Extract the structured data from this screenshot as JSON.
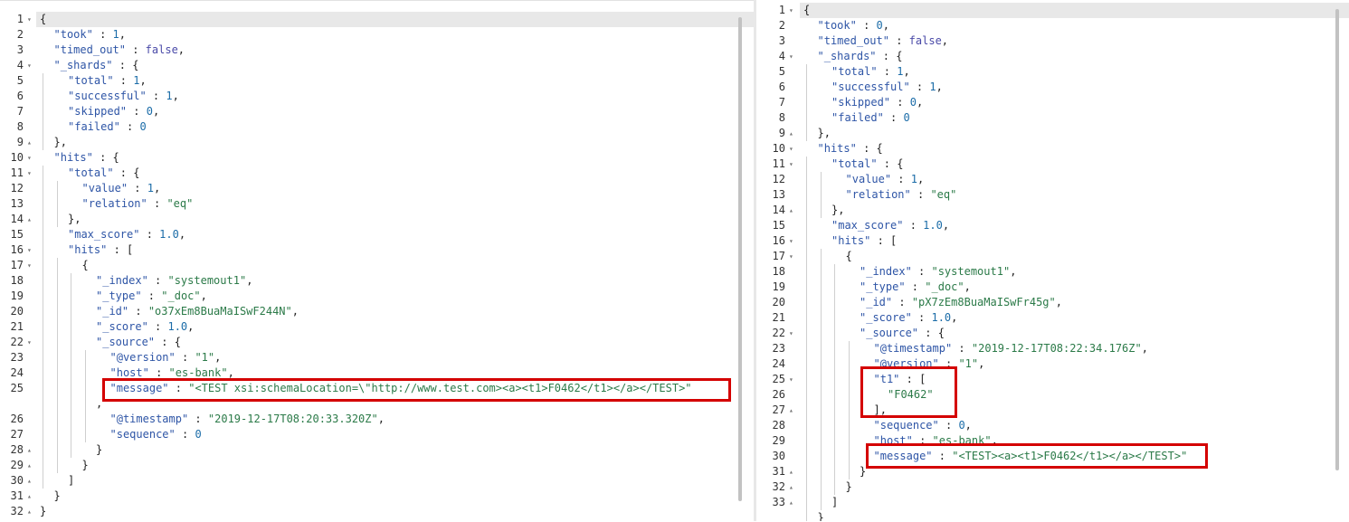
{
  "left_editor": {
    "lines": [
      {
        "n": "1",
        "fold": "down",
        "segs": [
          [
            "p",
            "{"
          ]
        ]
      },
      {
        "n": "2",
        "segs": [
          [
            "k",
            "\"took\""
          ],
          [
            "p",
            " : "
          ],
          [
            "n",
            "1"
          ],
          [
            "p",
            ","
          ]
        ]
      },
      {
        "n": "3",
        "segs": [
          [
            "k",
            "\"timed_out\""
          ],
          [
            "p",
            " : "
          ],
          [
            "b",
            "false"
          ],
          [
            "p",
            ","
          ]
        ]
      },
      {
        "n": "4",
        "fold": "down",
        "segs": [
          [
            "k",
            "\"_shards\""
          ],
          [
            "p",
            " : {"
          ]
        ]
      },
      {
        "n": "5",
        "segs": [
          [
            "k",
            "\"total\""
          ],
          [
            "p",
            " : "
          ],
          [
            "n",
            "1"
          ],
          [
            "p",
            ","
          ]
        ]
      },
      {
        "n": "6",
        "segs": [
          [
            "k",
            "\"successful\""
          ],
          [
            "p",
            " : "
          ],
          [
            "n",
            "1"
          ],
          [
            "p",
            ","
          ]
        ]
      },
      {
        "n": "7",
        "segs": [
          [
            "k",
            "\"skipped\""
          ],
          [
            "p",
            " : "
          ],
          [
            "n",
            "0"
          ],
          [
            "p",
            ","
          ]
        ]
      },
      {
        "n": "8",
        "segs": [
          [
            "k",
            "\"failed\""
          ],
          [
            "p",
            " : "
          ],
          [
            "n",
            "0"
          ]
        ]
      },
      {
        "n": "9",
        "fold": "up",
        "segs": [
          [
            "p",
            "},"
          ]
        ]
      },
      {
        "n": "10",
        "fold": "down",
        "segs": [
          [
            "k",
            "\"hits\""
          ],
          [
            "p",
            " : {"
          ]
        ]
      },
      {
        "n": "11",
        "fold": "down",
        "segs": [
          [
            "k",
            "\"total\""
          ],
          [
            "p",
            " : {"
          ]
        ]
      },
      {
        "n": "12",
        "segs": [
          [
            "k",
            "\"value\""
          ],
          [
            "p",
            " : "
          ],
          [
            "n",
            "1"
          ],
          [
            "p",
            ","
          ]
        ]
      },
      {
        "n": "13",
        "segs": [
          [
            "k",
            "\"relation\""
          ],
          [
            "p",
            " : "
          ],
          [
            "s",
            "\"eq\""
          ]
        ]
      },
      {
        "n": "14",
        "fold": "up",
        "segs": [
          [
            "p",
            "},"
          ]
        ]
      },
      {
        "n": "15",
        "segs": [
          [
            "k",
            "\"max_score\""
          ],
          [
            "p",
            " : "
          ],
          [
            "n",
            "1.0"
          ],
          [
            "p",
            ","
          ]
        ]
      },
      {
        "n": "16",
        "fold": "down",
        "segs": [
          [
            "k",
            "\"hits\""
          ],
          [
            "p",
            " : ["
          ]
        ]
      },
      {
        "n": "17",
        "fold": "down",
        "segs": [
          [
            "p",
            "{"
          ]
        ]
      },
      {
        "n": "18",
        "segs": [
          [
            "k",
            "\"_index\""
          ],
          [
            "p",
            " : "
          ],
          [
            "s",
            "\"systemout1\""
          ],
          [
            "p",
            ","
          ]
        ]
      },
      {
        "n": "19",
        "segs": [
          [
            "k",
            "\"_type\""
          ],
          [
            "p",
            " : "
          ],
          [
            "s",
            "\"_doc\""
          ],
          [
            "p",
            ","
          ]
        ]
      },
      {
        "n": "20",
        "segs": [
          [
            "k",
            "\"_id\""
          ],
          [
            "p",
            " : "
          ],
          [
            "s",
            "\"o37xEm8BuaMaISwF244N\""
          ],
          [
            "p",
            ","
          ]
        ]
      },
      {
        "n": "21",
        "segs": [
          [
            "k",
            "\"_score\""
          ],
          [
            "p",
            " : "
          ],
          [
            "n",
            "1.0"
          ],
          [
            "p",
            ","
          ]
        ]
      },
      {
        "n": "22",
        "fold": "down",
        "segs": [
          [
            "k",
            "\"_source\""
          ],
          [
            "p",
            " : {"
          ]
        ]
      },
      {
        "n": "23",
        "segs": [
          [
            "k",
            "\"@version\""
          ],
          [
            "p",
            " : "
          ],
          [
            "s",
            "\"1\""
          ],
          [
            "p",
            ","
          ]
        ]
      },
      {
        "n": "24",
        "segs": [
          [
            "k",
            "\"host\""
          ],
          [
            "p",
            " : "
          ],
          [
            "s",
            "\"es-bank\""
          ],
          [
            "p",
            ","
          ]
        ]
      },
      {
        "n": "25",
        "segs": [
          [
            "k",
            "\"message\""
          ],
          [
            "p",
            " : "
          ],
          [
            "s",
            "\"<TEST xsi:schemaLocation=\\\"http://www.test.com><a><t1>F0462</t1></a></TEST>\""
          ]
        ]
      },
      {
        "n": "",
        "segs": [
          [
            "p",
            ","
          ]
        ]
      },
      {
        "n": "26",
        "segs": [
          [
            "k",
            "\"@timestamp\""
          ],
          [
            "p",
            " : "
          ],
          [
            "s",
            "\"2019-12-17T08:20:33.320Z\""
          ],
          [
            "p",
            ","
          ]
        ]
      },
      {
        "n": "27",
        "segs": [
          [
            "k",
            "\"sequence\""
          ],
          [
            "p",
            " : "
          ],
          [
            "n",
            "0"
          ]
        ]
      },
      {
        "n": "28",
        "fold": "up",
        "segs": [
          [
            "p",
            "}"
          ]
        ]
      },
      {
        "n": "29",
        "fold": "up",
        "segs": [
          [
            "p",
            "}"
          ]
        ]
      },
      {
        "n": "30",
        "fold": "up",
        "segs": [
          [
            "p",
            "]"
          ]
        ]
      },
      {
        "n": "31",
        "fold": "up",
        "segs": [
          [
            "p",
            "}"
          ]
        ]
      },
      {
        "n": "32",
        "fold": "up",
        "segs": [
          [
            "p",
            "}"
          ]
        ]
      }
    ]
  },
  "right_editor": {
    "lines": [
      {
        "n": "1",
        "fold": "down",
        "segs": [
          [
            "p",
            "{"
          ]
        ]
      },
      {
        "n": "2",
        "segs": [
          [
            "k",
            "\"took\""
          ],
          [
            "p",
            " : "
          ],
          [
            "n",
            "0"
          ],
          [
            "p",
            ","
          ]
        ]
      },
      {
        "n": "3",
        "segs": [
          [
            "k",
            "\"timed_out\""
          ],
          [
            "p",
            " : "
          ],
          [
            "b",
            "false"
          ],
          [
            "p",
            ","
          ]
        ]
      },
      {
        "n": "4",
        "fold": "down",
        "segs": [
          [
            "k",
            "\"_shards\""
          ],
          [
            "p",
            " : {"
          ]
        ]
      },
      {
        "n": "5",
        "segs": [
          [
            "k",
            "\"total\""
          ],
          [
            "p",
            " : "
          ],
          [
            "n",
            "1"
          ],
          [
            "p",
            ","
          ]
        ]
      },
      {
        "n": "6",
        "segs": [
          [
            "k",
            "\"successful\""
          ],
          [
            "p",
            " : "
          ],
          [
            "n",
            "1"
          ],
          [
            "p",
            ","
          ]
        ]
      },
      {
        "n": "7",
        "segs": [
          [
            "k",
            "\"skipped\""
          ],
          [
            "p",
            " : "
          ],
          [
            "n",
            "0"
          ],
          [
            "p",
            ","
          ]
        ]
      },
      {
        "n": "8",
        "segs": [
          [
            "k",
            "\"failed\""
          ],
          [
            "p",
            " : "
          ],
          [
            "n",
            "0"
          ]
        ]
      },
      {
        "n": "9",
        "fold": "up",
        "segs": [
          [
            "p",
            "},"
          ]
        ]
      },
      {
        "n": "10",
        "fold": "down",
        "segs": [
          [
            "k",
            "\"hits\""
          ],
          [
            "p",
            " : {"
          ]
        ]
      },
      {
        "n": "11",
        "fold": "down",
        "segs": [
          [
            "k",
            "\"total\""
          ],
          [
            "p",
            " : {"
          ]
        ]
      },
      {
        "n": "12",
        "segs": [
          [
            "k",
            "\"value\""
          ],
          [
            "p",
            " : "
          ],
          [
            "n",
            "1"
          ],
          [
            "p",
            ","
          ]
        ]
      },
      {
        "n": "13",
        "segs": [
          [
            "k",
            "\"relation\""
          ],
          [
            "p",
            " : "
          ],
          [
            "s",
            "\"eq\""
          ]
        ]
      },
      {
        "n": "14",
        "fold": "up",
        "segs": [
          [
            "p",
            "},"
          ]
        ]
      },
      {
        "n": "15",
        "segs": [
          [
            "k",
            "\"max_score\""
          ],
          [
            "p",
            " : "
          ],
          [
            "n",
            "1.0"
          ],
          [
            "p",
            ","
          ]
        ]
      },
      {
        "n": "16",
        "fold": "down",
        "segs": [
          [
            "k",
            "\"hits\""
          ],
          [
            "p",
            " : ["
          ]
        ]
      },
      {
        "n": "17",
        "fold": "down",
        "segs": [
          [
            "p",
            "{"
          ]
        ]
      },
      {
        "n": "18",
        "segs": [
          [
            "k",
            "\"_index\""
          ],
          [
            "p",
            " : "
          ],
          [
            "s",
            "\"systemout1\""
          ],
          [
            "p",
            ","
          ]
        ]
      },
      {
        "n": "19",
        "segs": [
          [
            "k",
            "\"_type\""
          ],
          [
            "p",
            " : "
          ],
          [
            "s",
            "\"_doc\""
          ],
          [
            "p",
            ","
          ]
        ]
      },
      {
        "n": "20",
        "segs": [
          [
            "k",
            "\"_id\""
          ],
          [
            "p",
            " : "
          ],
          [
            "s",
            "\"pX7zEm8BuaMaISwFr45g\""
          ],
          [
            "p",
            ","
          ]
        ]
      },
      {
        "n": "21",
        "segs": [
          [
            "k",
            "\"_score\""
          ],
          [
            "p",
            " : "
          ],
          [
            "n",
            "1.0"
          ],
          [
            "p",
            ","
          ]
        ]
      },
      {
        "n": "22",
        "fold": "down",
        "segs": [
          [
            "k",
            "\"_source\""
          ],
          [
            "p",
            " : {"
          ]
        ]
      },
      {
        "n": "23",
        "segs": [
          [
            "k",
            "\"@timestamp\""
          ],
          [
            "p",
            " : "
          ],
          [
            "s",
            "\"2019-12-17T08:22:34.176Z\""
          ],
          [
            "p",
            ","
          ]
        ]
      },
      {
        "n": "24",
        "segs": [
          [
            "k",
            "\"@version\""
          ],
          [
            "p",
            " : "
          ],
          [
            "s",
            "\"1\""
          ],
          [
            "p",
            ","
          ]
        ]
      },
      {
        "n": "25",
        "fold": "down",
        "segs": [
          [
            "k",
            "\"t1\""
          ],
          [
            "p",
            " : ["
          ]
        ]
      },
      {
        "n": "26",
        "segs": [
          [
            "s",
            "\"F0462\""
          ]
        ]
      },
      {
        "n": "27",
        "fold": "up",
        "segs": [
          [
            "p",
            "],"
          ]
        ]
      },
      {
        "n": "28",
        "segs": [
          [
            "k",
            "\"sequence\""
          ],
          [
            "p",
            " : "
          ],
          [
            "n",
            "0"
          ],
          [
            "p",
            ","
          ]
        ]
      },
      {
        "n": "29",
        "segs": [
          [
            "k",
            "\"host\""
          ],
          [
            "p",
            " : "
          ],
          [
            "s",
            "\"es-bank\""
          ],
          [
            "p",
            ","
          ]
        ]
      },
      {
        "n": "30",
        "segs": [
          [
            "k",
            "\"message\""
          ],
          [
            "p",
            " : "
          ],
          [
            "s",
            "\"<TEST><a><t1>F0462</t1></a></TEST>\""
          ]
        ]
      },
      {
        "n": "31",
        "fold": "up",
        "segs": [
          [
            "p",
            "}"
          ]
        ]
      },
      {
        "n": "32",
        "fold": "up",
        "segs": [
          [
            "p",
            "}"
          ]
        ]
      },
      {
        "n": "33",
        "fold": "up",
        "segs": [
          [
            "p",
            "]"
          ]
        ]
      },
      {
        "n": "",
        "segs": [
          [
            "p",
            "}"
          ]
        ]
      }
    ]
  }
}
